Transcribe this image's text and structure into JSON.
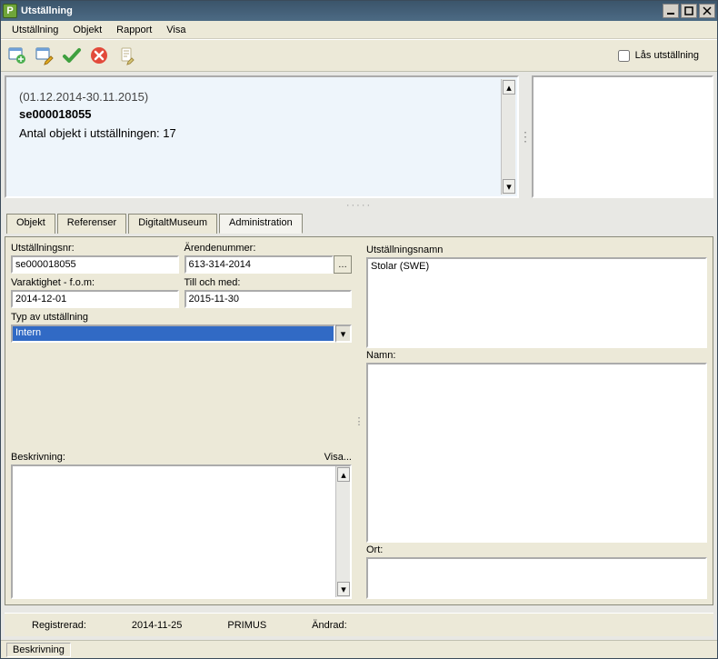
{
  "window": {
    "title": "Utställning"
  },
  "menu": {
    "utstallning": "Utställning",
    "objekt": "Objekt",
    "rapport": "Rapport",
    "visa": "Visa"
  },
  "toolbar": {
    "lock_label": "Lås utställning"
  },
  "summary": {
    "date_range": "(01.12.2014-30.11.2015)",
    "exh_id": "se000018055",
    "count_line": "Antal objekt i utställningen: 17"
  },
  "tabs": {
    "objekt": "Objekt",
    "referenser": "Referenser",
    "digitalt": "DigitaltMuseum",
    "admin": "Administration"
  },
  "form": {
    "utstallningsnr_label": "Utställningsnr:",
    "utstallningsnr": "se000018055",
    "arendenummer_label": "Ärendenummer:",
    "arendenummer": "613-314-2014",
    "varaktighet_label": "Varaktighet - f.o.m:",
    "varaktighet": "2014-12-01",
    "till_label": "Till och med:",
    "till": "2015-11-30",
    "typ_label": "Typ av utställning",
    "typ": "Intern",
    "beskrivning_label": "Beskrivning:",
    "visa_label": "Visa...",
    "utstallningsnamn_label": "Utställningsnamn",
    "utstallningsnamn": "Stolar (SWE)",
    "namn_label": "Namn:",
    "ort_label": "Ort:"
  },
  "status": {
    "registrerad_label": "Registrerad:",
    "registrerad_date": "2014-11-25",
    "registrerad_user": "PRIMUS",
    "andrad_label": "Ändrad:"
  },
  "footer": {
    "beskrivning": "Beskrivning"
  }
}
